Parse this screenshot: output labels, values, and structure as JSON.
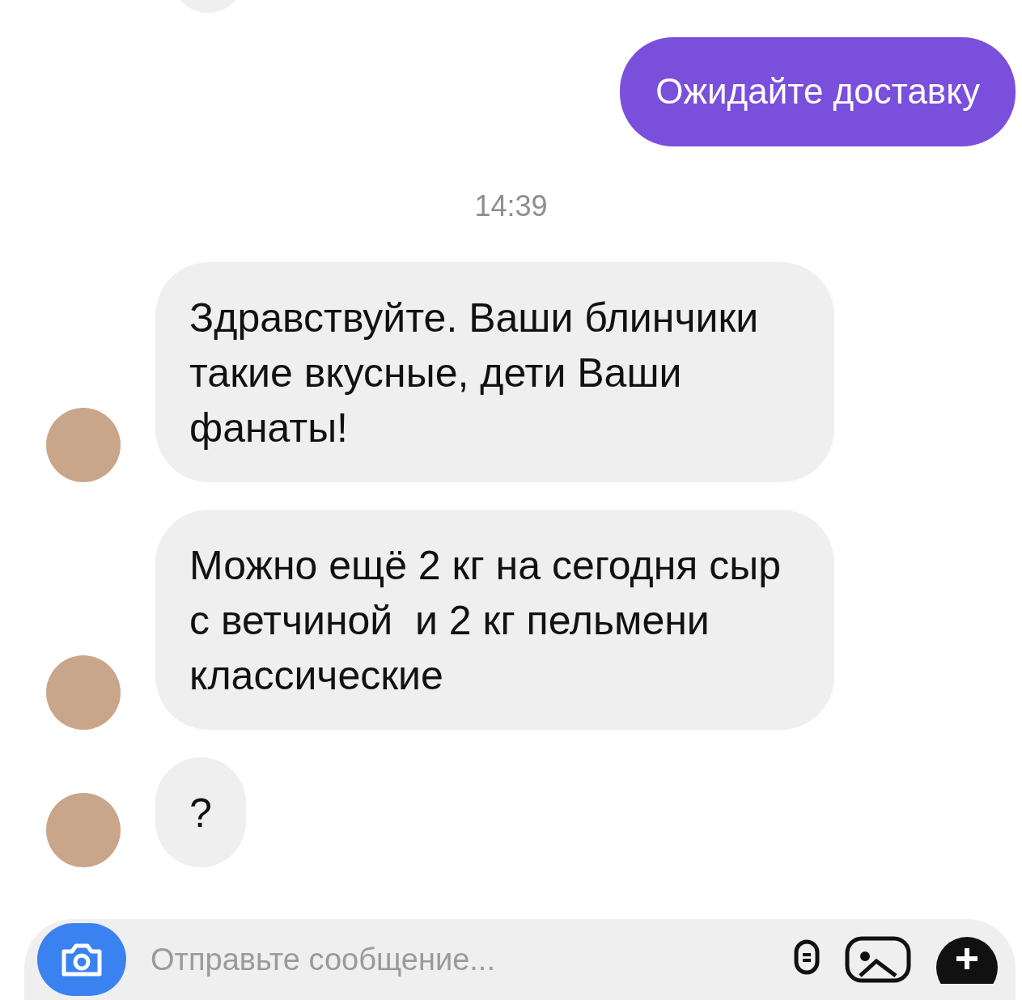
{
  "messages": [
    {
      "kind": "outgoing",
      "text": "Ожидайте доставку"
    },
    {
      "kind": "time",
      "text": "14:39"
    },
    {
      "kind": "incoming",
      "text": "Здравствуйте. Ваши блинчики такие вкусные, дети Ваши фанаты!"
    },
    {
      "kind": "incoming",
      "text": "Можно ещё 2 кг на сегодня сыр с ветчиной  и 2 кг пельмени классические"
    },
    {
      "kind": "incoming",
      "text": "?"
    }
  ],
  "composer": {
    "placeholder": "Отправьте сообщение..."
  }
}
